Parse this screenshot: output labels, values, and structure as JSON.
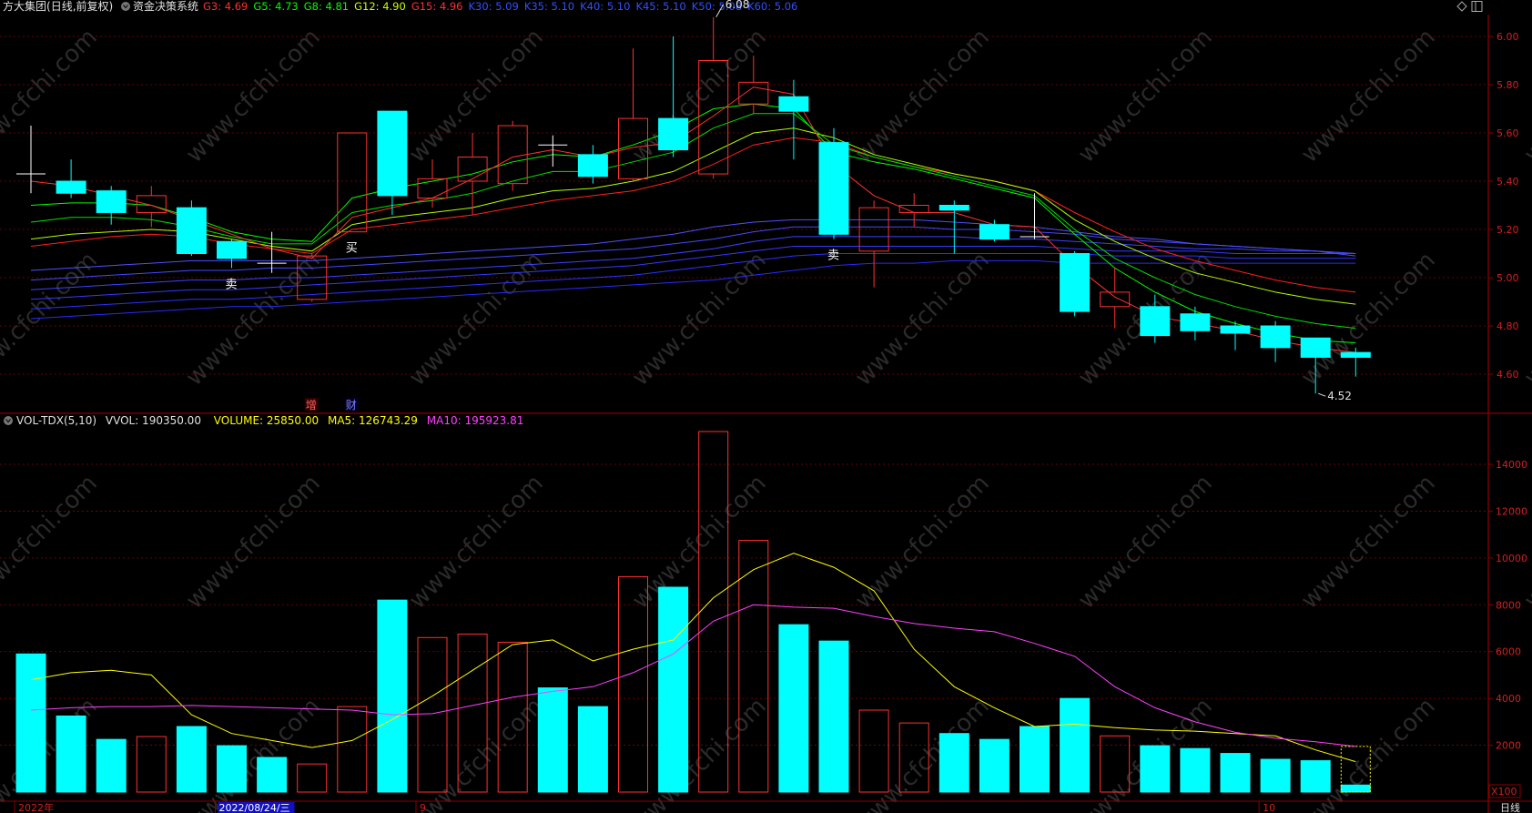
{
  "header": {
    "stock_name": "方大集团",
    "mode": "(日线,前复权)",
    "system": "资金决策系统",
    "indicators": [
      {
        "label": "G3",
        "value": "4.69",
        "color": "#ff3030"
      },
      {
        "label": "G5",
        "value": "4.73",
        "color": "#00ff00"
      },
      {
        "label": "G8",
        "value": "4.81",
        "color": "#00ff00"
      },
      {
        "label": "G12",
        "value": "4.90",
        "color": "#c8ff00"
      },
      {
        "label": "G15",
        "value": "4.96",
        "color": "#ff3030"
      },
      {
        "label": "K30",
        "value": "5.09",
        "color": "#3050ff"
      },
      {
        "label": "K35",
        "value": "5.10",
        "color": "#3050ff"
      },
      {
        "label": "K40",
        "value": "5.10",
        "color": "#3050ff"
      },
      {
        "label": "K45",
        "value": "5.10",
        "color": "#3050ff"
      },
      {
        "label": "K50",
        "value": "5.08",
        "color": "#3050ff"
      },
      {
        "label": "K60",
        "value": "5.06",
        "color": "#3050ff"
      }
    ]
  },
  "vol_header": {
    "name": "VOL-TDX(5,10)",
    "vvol": "VVOL: 190350.00",
    "volume": "VOLUME: 25850.00",
    "ma5": "MA5: 126743.29",
    "ma10": "MA10: 195923.81",
    "colors": {
      "vvol": "#dddddd",
      "volume": "#ffff00",
      "ma5": "#ffff00",
      "ma10": "#ff40ff"
    }
  },
  "colors": {
    "up": "#ff3030",
    "down": "#00ffff",
    "grid": "#8b0000",
    "axis_text": "#d02020",
    "ma_vol5": "#ffff00",
    "ma_vol10": "#ff40ff"
  },
  "chart_data": [
    {
      "type": "candlestick",
      "title": "方大集团 日线 前复权",
      "yticks": [
        "4.60",
        "4.80",
        "5.00",
        "5.20",
        "5.40",
        "5.60",
        "5.80",
        "6.00"
      ],
      "ylim": [
        4.4,
        6.1
      ],
      "grid": true,
      "candles": [
        {
          "open": 5.43,
          "close": 5.43,
          "high": 5.63,
          "low": 5.35
        },
        {
          "open": 5.4,
          "close": 5.35,
          "high": 5.49,
          "low": 5.33
        },
        {
          "open": 5.36,
          "close": 5.27,
          "high": 5.38,
          "low": 5.22
        },
        {
          "open": 5.27,
          "close": 5.34,
          "high": 5.38,
          "low": 5.21
        },
        {
          "open": 5.29,
          "close": 5.1,
          "high": 5.32,
          "low": 5.09
        },
        {
          "open": 5.15,
          "close": 5.08,
          "high": 5.16,
          "low": 5.04
        },
        {
          "open": 5.06,
          "close": 5.06,
          "high": 5.19,
          "low": 5.02
        },
        {
          "open": 4.91,
          "close": 5.09,
          "high": 5.1,
          "low": 4.9
        },
        {
          "open": 5.19,
          "close": 5.6,
          "high": 5.6,
          "low": 5.19
        },
        {
          "open": 5.69,
          "close": 5.34,
          "high": 5.69,
          "low": 5.26
        },
        {
          "open": 5.33,
          "close": 5.41,
          "high": 5.49,
          "low": 5.29
        },
        {
          "open": 5.4,
          "close": 5.5,
          "high": 5.6,
          "low": 5.26
        },
        {
          "open": 5.39,
          "close": 5.63,
          "high": 5.65,
          "low": 5.36
        },
        {
          "open": 5.55,
          "close": 5.55,
          "high": 5.59,
          "low": 5.46
        },
        {
          "open": 5.51,
          "close": 5.42,
          "high": 5.55,
          "low": 5.39
        },
        {
          "open": 5.41,
          "close": 5.66,
          "high": 5.95,
          "low": 5.4
        },
        {
          "open": 5.66,
          "close": 5.53,
          "high": 6.0,
          "low": 5.5
        },
        {
          "open": 5.43,
          "close": 5.9,
          "high": 6.08,
          "low": 5.41
        },
        {
          "open": 5.72,
          "close": 5.81,
          "high": 5.92,
          "low": 5.68
        },
        {
          "open": 5.75,
          "close": 5.69,
          "high": 5.82,
          "low": 5.49
        },
        {
          "open": 5.56,
          "close": 5.18,
          "high": 5.62,
          "low": 5.16
        },
        {
          "open": 5.11,
          "close": 5.29,
          "high": 5.32,
          "low": 4.96
        },
        {
          "open": 5.27,
          "close": 5.3,
          "high": 5.35,
          "low": 5.21
        },
        {
          "open": 5.3,
          "close": 5.28,
          "high": 5.32,
          "low": 5.1
        },
        {
          "open": 5.22,
          "close": 5.16,
          "high": 5.24,
          "low": 5.15
        },
        {
          "open": 5.17,
          "close": 5.17,
          "high": 5.35,
          "low": 5.16
        },
        {
          "open": 5.1,
          "close": 4.86,
          "high": 5.11,
          "low": 4.84
        },
        {
          "open": 4.88,
          "close": 4.94,
          "high": 5.04,
          "low": 4.79
        },
        {
          "open": 4.88,
          "close": 4.76,
          "high": 4.93,
          "low": 4.73
        },
        {
          "open": 4.85,
          "close": 4.78,
          "high": 4.88,
          "low": 4.74
        },
        {
          "open": 4.8,
          "close": 4.77,
          "high": 4.82,
          "low": 4.7
        },
        {
          "open": 4.8,
          "close": 4.71,
          "high": 4.82,
          "low": 4.65
        },
        {
          "open": 4.75,
          "close": 4.67,
          "high": 4.75,
          "low": 4.52
        },
        {
          "open": 4.69,
          "close": 4.67,
          "high": 4.71,
          "low": 4.59
        }
      ],
      "ma_lines": [
        {
          "name": "K60",
          "color": "#2a2aff",
          "values": [
            4.83,
            4.84,
            4.85,
            4.86,
            4.87,
            4.88,
            4.88,
            4.89,
            4.9,
            4.91,
            4.92,
            4.93,
            4.94,
            4.95,
            4.96,
            4.97,
            4.98,
            4.99,
            5.01,
            5.03,
            5.05,
            5.06,
            5.06,
            5.07,
            5.07,
            5.07,
            5.06,
            5.06,
            5.06,
            5.06,
            5.06,
            5.06,
            5.06,
            5.06
          ]
        },
        {
          "name": "K50",
          "color": "#3030ff",
          "values": [
            4.87,
            4.88,
            4.89,
            4.9,
            4.91,
            4.91,
            4.92,
            4.93,
            4.94,
            4.95,
            4.96,
            4.97,
            4.98,
            4.99,
            5.0,
            5.01,
            5.03,
            5.05,
            5.07,
            5.09,
            5.1,
            5.1,
            5.1,
            5.1,
            5.1,
            5.1,
            5.1,
            5.09,
            5.09,
            5.09,
            5.08,
            5.08,
            5.08,
            5.08
          ]
        },
        {
          "name": "K45",
          "color": "#3838ff",
          "values": [
            4.91,
            4.92,
            4.93,
            4.94,
            4.95,
            4.95,
            4.96,
            4.97,
            4.98,
            4.99,
            5.0,
            5.01,
            5.02,
            5.03,
            5.04,
            5.05,
            5.07,
            5.09,
            5.11,
            5.13,
            5.13,
            5.13,
            5.13,
            5.13,
            5.13,
            5.13,
            5.12,
            5.11,
            5.11,
            5.11,
            5.1,
            5.1,
            5.1,
            5.1
          ]
        },
        {
          "name": "K40",
          "color": "#4040ff",
          "values": [
            4.95,
            4.96,
            4.97,
            4.98,
            4.99,
            4.99,
            5.0,
            5.0,
            5.01,
            5.02,
            5.03,
            5.04,
            5.05,
            5.06,
            5.07,
            5.08,
            5.1,
            5.12,
            5.15,
            5.17,
            5.17,
            5.17,
            5.17,
            5.17,
            5.16,
            5.16,
            5.15,
            5.14,
            5.13,
            5.12,
            5.12,
            5.11,
            5.11,
            5.1
          ]
        },
        {
          "name": "K35",
          "color": "#4848ff",
          "values": [
            4.99,
            5.0,
            5.01,
            5.02,
            5.03,
            5.03,
            5.04,
            5.04,
            5.05,
            5.06,
            5.07,
            5.08,
            5.09,
            5.1,
            5.11,
            5.12,
            5.14,
            5.16,
            5.19,
            5.21,
            5.21,
            5.21,
            5.21,
            5.2,
            5.2,
            5.19,
            5.18,
            5.16,
            5.15,
            5.14,
            5.13,
            5.12,
            5.11,
            5.1
          ]
        },
        {
          "name": "K30",
          "color": "#5050ff",
          "values": [
            5.03,
            5.04,
            5.05,
            5.06,
            5.07,
            5.07,
            5.07,
            5.07,
            5.08,
            5.09,
            5.1,
            5.11,
            5.12,
            5.13,
            5.14,
            5.16,
            5.18,
            5.21,
            5.23,
            5.24,
            5.24,
            5.24,
            5.24,
            5.23,
            5.22,
            5.21,
            5.19,
            5.17,
            5.16,
            5.14,
            5.13,
            5.12,
            5.11,
            5.09
          ]
        },
        {
          "name": "G15",
          "color": "#ff2020",
          "values": [
            5.13,
            5.15,
            5.17,
            5.18,
            5.17,
            5.14,
            5.12,
            5.1,
            5.2,
            5.22,
            5.24,
            5.26,
            5.29,
            5.32,
            5.34,
            5.36,
            5.4,
            5.47,
            5.55,
            5.58,
            5.56,
            5.5,
            5.46,
            5.43,
            5.4,
            5.36,
            5.27,
            5.19,
            5.12,
            5.07,
            5.03,
            4.99,
            4.96,
            4.94
          ]
        },
        {
          "name": "G12",
          "color": "#b0ff00",
          "values": [
            5.16,
            5.18,
            5.19,
            5.2,
            5.19,
            5.16,
            5.13,
            5.11,
            5.22,
            5.25,
            5.27,
            5.29,
            5.33,
            5.36,
            5.37,
            5.4,
            5.44,
            5.52,
            5.6,
            5.62,
            5.58,
            5.51,
            5.47,
            5.43,
            5.4,
            5.36,
            5.24,
            5.15,
            5.08,
            5.02,
            4.98,
            4.94,
            4.91,
            4.89
          ]
        },
        {
          "name": "G8",
          "color": "#00e000",
          "values": [
            5.23,
            5.25,
            5.25,
            5.24,
            5.21,
            5.17,
            5.14,
            5.14,
            5.27,
            5.3,
            5.32,
            5.35,
            5.4,
            5.44,
            5.44,
            5.48,
            5.52,
            5.62,
            5.68,
            5.68,
            5.55,
            5.5,
            5.46,
            5.42,
            5.38,
            5.34,
            5.2,
            5.08,
            5.0,
            4.93,
            4.88,
            4.84,
            4.81,
            4.79
          ]
        },
        {
          "name": "G5",
          "color": "#00ff00",
          "values": [
            5.3,
            5.31,
            5.31,
            5.3,
            5.25,
            5.19,
            5.16,
            5.15,
            5.33,
            5.37,
            5.4,
            5.43,
            5.48,
            5.51,
            5.5,
            5.55,
            5.61,
            5.7,
            5.72,
            5.7,
            5.52,
            5.48,
            5.45,
            5.41,
            5.37,
            5.33,
            5.18,
            5.04,
            4.94,
            4.86,
            4.81,
            4.77,
            4.74,
            4.73
          ]
        },
        {
          "name": "G3",
          "color": "#ff3030",
          "values": [
            5.4,
            5.38,
            5.34,
            5.3,
            5.24,
            5.18,
            5.12,
            5.08,
            5.25,
            5.29,
            5.33,
            5.41,
            5.5,
            5.53,
            5.5,
            5.54,
            5.56,
            5.67,
            5.79,
            5.76,
            5.47,
            5.34,
            5.27,
            5.27,
            5.22,
            5.21,
            5.05,
            4.92,
            4.84,
            4.81,
            4.78,
            4.74,
            4.71,
            4.69
          ]
        }
      ],
      "annotations": [
        {
          "text": "6.08",
          "index": 17,
          "price": 6.08
        },
        {
          "text": "4.52",
          "index": 32,
          "price": 4.52
        }
      ],
      "signals": [
        {
          "text": "卖",
          "index": 5
        },
        {
          "text": "买",
          "index": 8
        },
        {
          "text": "卖",
          "index": 20
        }
      ],
      "bottom_tags": [
        {
          "text": "增",
          "index": 7
        },
        {
          "text": "财",
          "index": 8
        }
      ]
    },
    {
      "type": "bar",
      "title": "VOL-TDX(5,10)",
      "ylim": [
        0,
        15000
      ],
      "yticks": [
        "2000",
        "4000",
        "6000",
        "8000",
        "10000",
        "12000",
        "14000"
      ],
      "unit": "X100",
      "grid": true,
      "volumes": [
        5900,
        3250,
        2250,
        2370,
        2800,
        1980,
        1480,
        1200,
        3650,
        8200,
        6600,
        6750,
        6400,
        4450,
        3650,
        9200,
        8750,
        15400,
        10750,
        7150,
        6450,
        3500,
        2950,
        2500,
        2250,
        2800,
        4000,
        2400,
        1980,
        1860,
        1650,
        1400,
        1340,
        300
      ],
      "ma5": [
        4800,
        5100,
        5200,
        5000,
        3300,
        2500,
        2200,
        1900,
        2200,
        3100,
        4100,
        5200,
        6300,
        6500,
        5600,
        6100,
        6500,
        8300,
        9500,
        10200,
        9600,
        8600,
        6100,
        4500,
        3600,
        2800,
        2900,
        2750,
        2650,
        2600,
        2500,
        2400,
        1800,
        1300
      ],
      "ma10": [
        3500,
        3600,
        3650,
        3650,
        3700,
        3650,
        3600,
        3550,
        3500,
        3300,
        3350,
        3700,
        4050,
        4300,
        4500,
        5100,
        5900,
        7300,
        8000,
        7900,
        7850,
        7500,
        7200,
        7000,
        6850,
        6350,
        5800,
        4500,
        3600,
        3000,
        2550,
        2300,
        2150,
        1950
      ]
    }
  ],
  "xaxis": {
    "labels": [
      {
        "text": "2022年",
        "index": 0,
        "highlight": false
      },
      {
        "text": "2022/08/24/三",
        "index": 5,
        "highlight": true
      },
      {
        "text": "9",
        "index": 10,
        "highlight": false
      },
      {
        "text": "10",
        "index": 31,
        "highlight": false
      }
    ],
    "right_label": "日线"
  },
  "watermark": "www.cfchi.com"
}
